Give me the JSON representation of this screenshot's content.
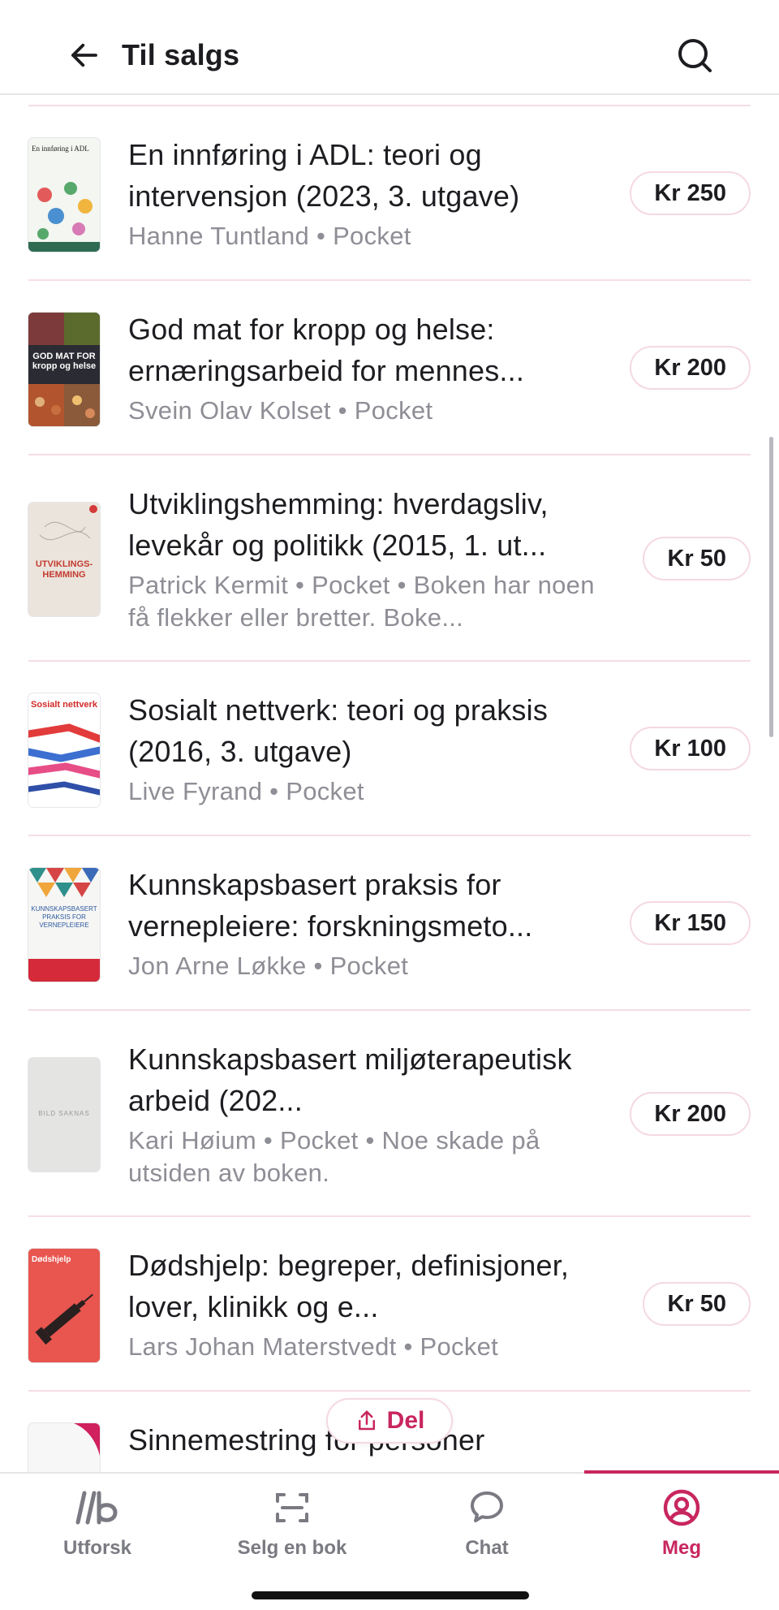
{
  "header": {
    "title": "Til salgs"
  },
  "books": [
    {
      "title": "En innføring i ADL: teori og intervensjon (2023, 3. utgave)",
      "meta": "Hanne Tuntland • Pocket",
      "price": "Kr 250",
      "cover": {
        "text": "En innføring i ADL",
        "subtext": "Hanne Tuntland"
      }
    },
    {
      "title": "God mat for kropp og helse: ernæringsarbeid for mennes...",
      "meta": "Svein Olav Kolset • Pocket",
      "price": "Kr 200",
      "cover": {
        "text": "GOD MAT FOR kropp og helse"
      }
    },
    {
      "title": "Utviklingshemming: hverdagsliv, levekår og politikk (2015, 1. ut...",
      "meta": "Patrick Kermit • Pocket • Boken har noen få flekker eller bretter. Boke...",
      "price": "Kr 50",
      "cover": {
        "text": "UTVIKLINGS-HEMMING"
      }
    },
    {
      "title": "Sosialt nettverk: teori og praksis (2016, 3. utgave)",
      "meta": "Live Fyrand • Pocket",
      "price": "Kr 100",
      "cover": {
        "text": "Sosialt nettverk"
      }
    },
    {
      "title": "Kunnskapsbasert praksis for vernepleiere: forskningsmeto...",
      "meta": "Jon Arne Løkke • Pocket",
      "price": "Kr 150",
      "cover": {
        "text": "KUNNSKAPSBASERT PRAKSIS FOR VERNEPLEIERE"
      }
    },
    {
      "title": "Kunnskapsbasert miljøterapeutisk arbeid (202...",
      "meta": "Kari Høium • Pocket • Noe skade på utsiden av boken.",
      "price": "Kr 200",
      "cover": {
        "text": "BILD SAKNAS"
      }
    },
    {
      "title": "Dødshjelp: begreper, definisjoner, lover, klinikk og e...",
      "meta": "Lars Johan Materstvedt • Pocket",
      "price": "Kr 50",
      "cover": {
        "text": "Dødshjelp"
      }
    },
    {
      "title": "Sinnemestring for personer",
      "meta": "",
      "price": "",
      "cover": {
        "text": ""
      }
    }
  ],
  "share": {
    "label": "Del"
  },
  "nav": {
    "explore": "Utforsk",
    "sell": "Selg en bok",
    "chat": "Chat",
    "me": "Meg"
  },
  "colors": {
    "accent": "#c8265f",
    "separator": "#f6dde5"
  }
}
